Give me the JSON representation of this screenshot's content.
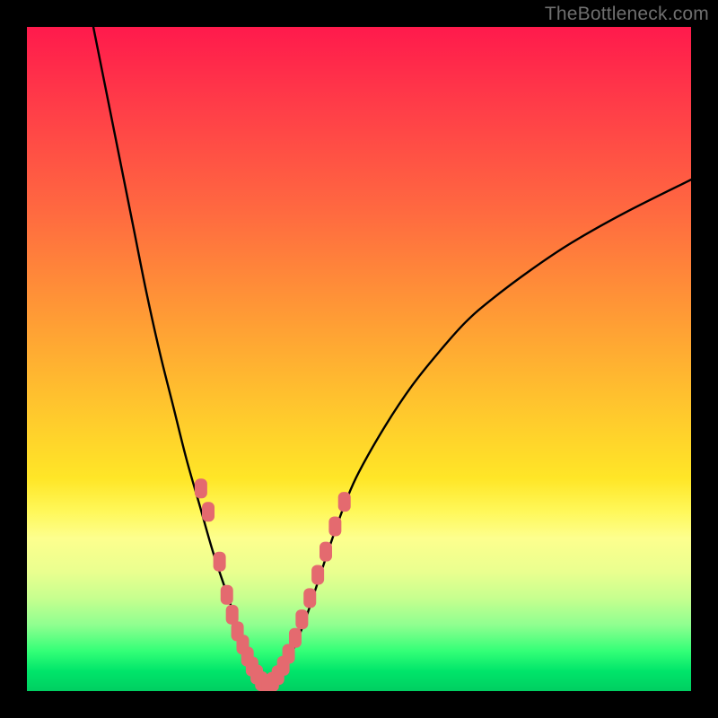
{
  "watermark": "TheBottleneck.com",
  "chart_data": {
    "type": "line",
    "title": "",
    "xlabel": "",
    "ylabel": "",
    "xlim": [
      0,
      100
    ],
    "ylim": [
      0,
      100
    ],
    "grid": false,
    "legend": false,
    "notes": "Bottleneck-style V-curve over a vertical red→yellow→green gradient. No axis ticks or numeric labels are rendered in the image; x/y are normalized 0–100. y=0 is the bottom (green) edge, y=100 is the top (red) edge.",
    "series": [
      {
        "name": "left-branch",
        "type": "curve",
        "x": [
          10,
          12,
          14,
          16,
          18,
          20,
          22,
          24,
          26,
          28,
          30,
          31,
          32,
          33,
          34,
          35,
          36
        ],
        "y": [
          100,
          90,
          80,
          70,
          60,
          51,
          43,
          35,
          28,
          21,
          15,
          12,
          9,
          6.5,
          4,
          2,
          0.5
        ]
      },
      {
        "name": "right-branch",
        "type": "curve",
        "x": [
          36,
          38,
          40,
          42,
          44,
          46,
          48,
          50,
          54,
          58,
          62,
          66,
          70,
          76,
          82,
          90,
          100
        ],
        "y": [
          0.5,
          2,
          6,
          11,
          17,
          23,
          28.5,
          33,
          40,
          46,
          51,
          55.5,
          59,
          63.5,
          67.5,
          72,
          77
        ]
      },
      {
        "name": "left-markers",
        "type": "markers",
        "color": "#e46a6f",
        "x": [
          26.2,
          27.3,
          29.0,
          30.1,
          30.9,
          31.7,
          32.5,
          33.2,
          33.9,
          34.6,
          35.3,
          35.9
        ],
        "y": [
          30.5,
          27.0,
          19.5,
          14.5,
          11.5,
          9.0,
          7.0,
          5.2,
          3.7,
          2.5,
          1.5,
          0.8
        ]
      },
      {
        "name": "right-markers",
        "type": "markers",
        "color": "#e46a6f",
        "x": [
          36.3,
          37.0,
          37.8,
          38.6,
          39.4,
          40.4,
          41.4,
          42.6,
          43.8,
          45.0,
          46.4,
          47.8
        ],
        "y": [
          0.8,
          1.4,
          2.4,
          3.8,
          5.6,
          8.0,
          10.8,
          14.0,
          17.5,
          21.0,
          24.8,
          28.5
        ]
      }
    ]
  }
}
